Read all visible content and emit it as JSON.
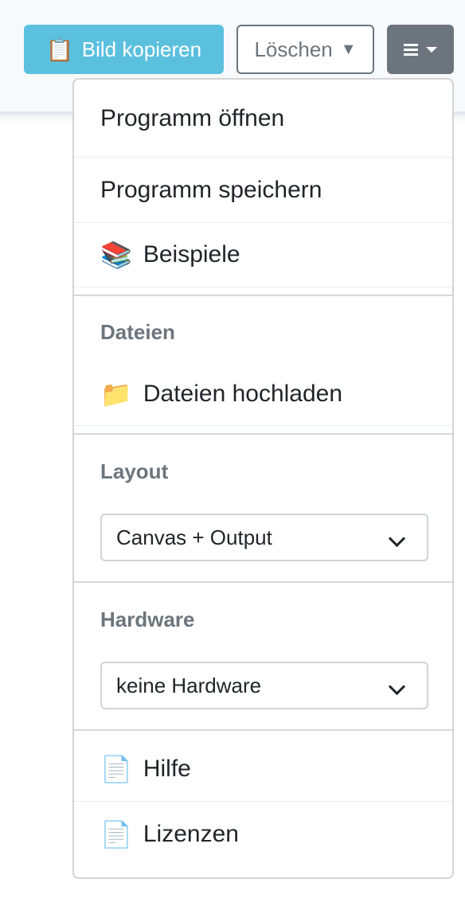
{
  "toolbar": {
    "copy_icon": "📋",
    "copy_label": "Bild kopieren",
    "delete_label": "Löschen",
    "delete_caret": "▼",
    "menu_icon": "hamburger-icon"
  },
  "colors": {
    "info": "#5bc0de",
    "secondary": "#6c757d"
  },
  "menu": {
    "open_program": "Programm öffnen",
    "save_program": "Programm speichern",
    "examples_icon": "📚",
    "examples": "Beispiele",
    "files_header": "Dateien",
    "upload_icon": "📁",
    "upload_files": "Dateien hochladen",
    "layout_header": "Layout",
    "layout_value": "Canvas + Output",
    "hardware_header": "Hardware",
    "hardware_value": "keine Hardware",
    "help_icon": "📄",
    "help": "Hilfe",
    "licenses_icon": "📄",
    "licenses": "Lizenzen"
  }
}
